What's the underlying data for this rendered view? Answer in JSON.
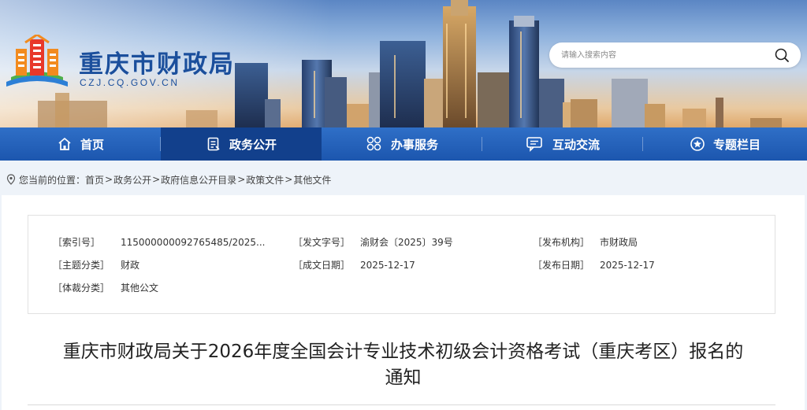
{
  "header": {
    "site_name": "重庆市财政局",
    "site_domain": "CZJ.CQ.GOV.CN",
    "search_placeholder": "请输入搜索内容"
  },
  "nav": {
    "items": [
      {
        "label": "首页",
        "icon": "home-icon"
      },
      {
        "label": "政务公开",
        "icon": "document-icon"
      },
      {
        "label": "办事服务",
        "icon": "services-grid-icon"
      },
      {
        "label": "互动交流",
        "icon": "chat-icon"
      },
      {
        "label": "专题栏目",
        "icon": "star-icon"
      }
    ],
    "active": "政务公开"
  },
  "breadcrumb": {
    "prefix": "您当前的位置：",
    "items": [
      "首页",
      "政务公开",
      "政府信息公开目录",
      "政策文件",
      "其他文件"
    ],
    "separator": ">"
  },
  "meta": {
    "index_no_label": "［索引号］",
    "index_no": "115000000092765485/2025...",
    "doc_no_label": "［发文字号］",
    "doc_no": "渝财会〔2025〕39号",
    "issuer_label": "［发布机构］",
    "issuer": "市财政局",
    "topic_label": "［主题分类］",
    "topic": "财政",
    "written_date_label": "［成文日期］",
    "written_date": "2025-12-17",
    "publish_date_label": "［发布日期］",
    "publish_date": "2025-12-17",
    "genre_label": "［体裁分类］",
    "genre": "其他公文"
  },
  "article": {
    "title_line1": "重庆市财政局关于2026年度全国会计专业技术初级会计资格考试（重庆考区）报名的",
    "title_line2": "通知"
  },
  "colors": {
    "nav_blue": "#1c56ae",
    "nav_active": "#12408c",
    "brand_blue": "#1b4f9c",
    "page_bg": "#eef3f9"
  }
}
